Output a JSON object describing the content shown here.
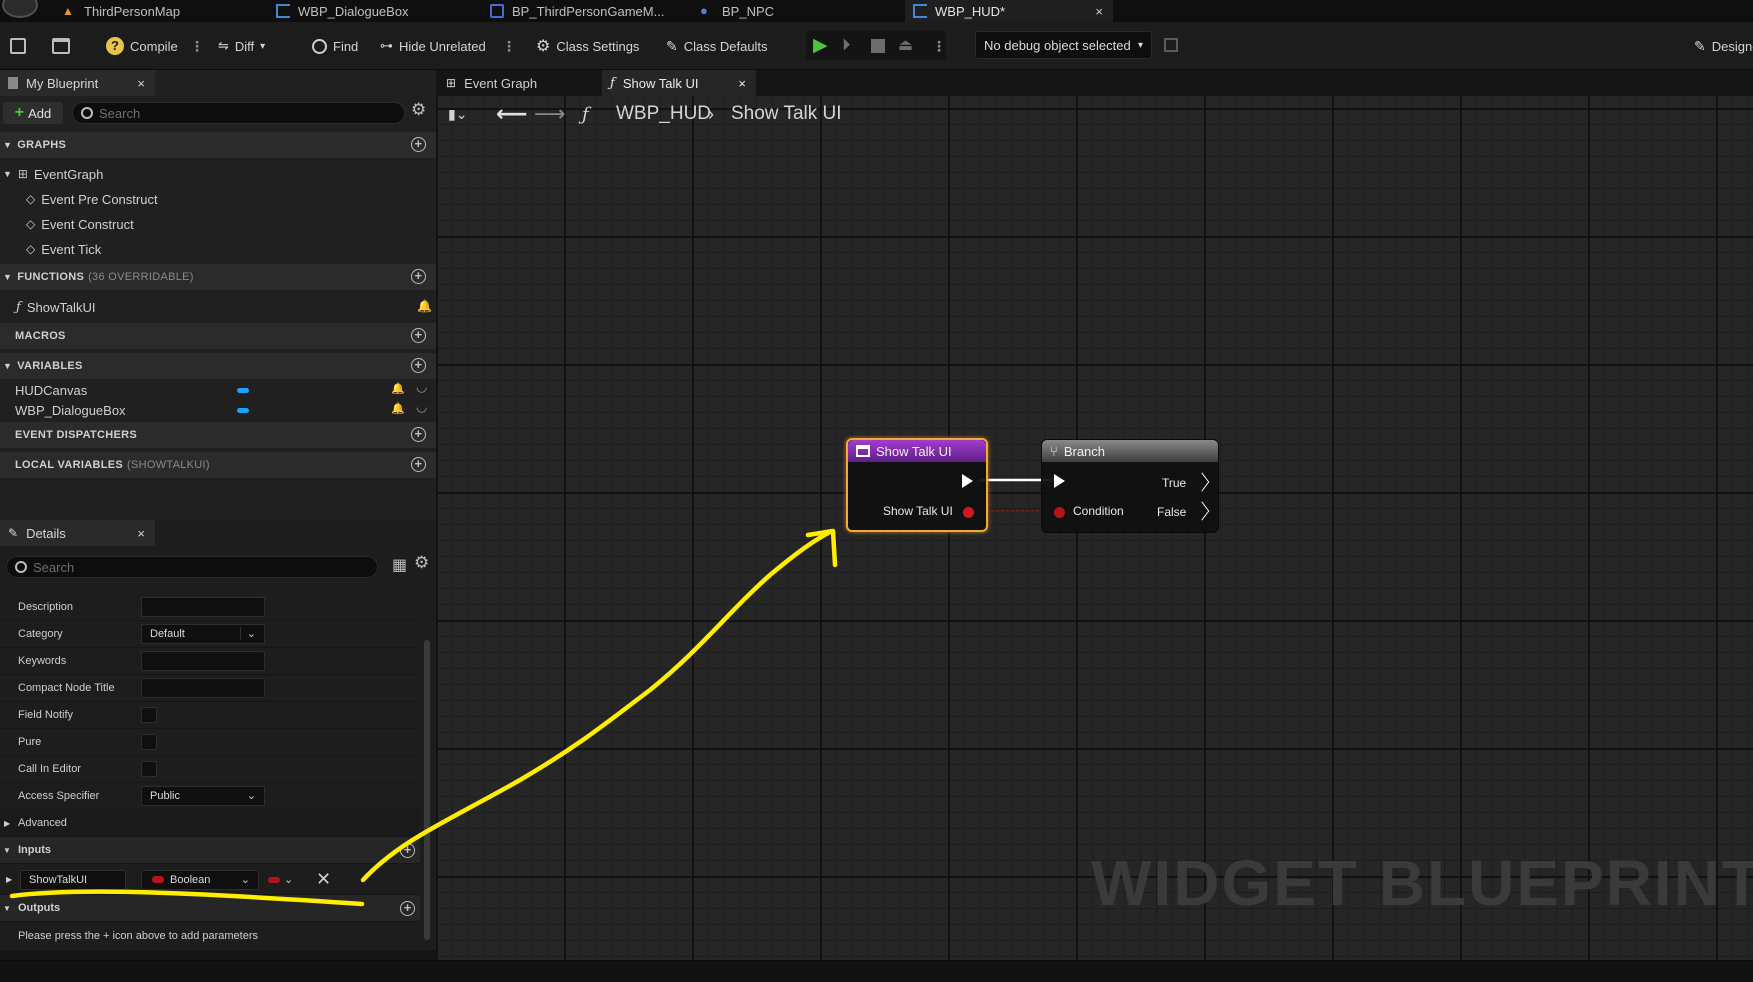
{
  "tabs": [
    {
      "label": "ThirdPersonMap",
      "icon": "level-icon"
    },
    {
      "label": "WBP_DialogueBox",
      "icon": "widget-blueprint-icon"
    },
    {
      "label": "BP_ThirdPersonGameM...",
      "icon": "blueprint-icon"
    },
    {
      "label": "BP_NPC",
      "icon": "character-icon"
    },
    {
      "label": "WBP_HUD*",
      "icon": "widget-blueprint-icon",
      "active": true
    }
  ],
  "toolbar": {
    "compile": "Compile",
    "diff": "Diff",
    "find": "Find",
    "hide_unrelated": "Hide Unrelated",
    "class_settings": "Class Settings",
    "class_defaults": "Class Defaults",
    "debug_select": "No debug object selected",
    "designer": "Designer"
  },
  "my_blueprint": {
    "tab_label": "My Blueprint",
    "add_label": "Add",
    "search_placeholder": "Search",
    "graphs_header": "GRAPHS",
    "event_graph": "EventGraph",
    "events": [
      "Event Pre Construct",
      "Event Construct",
      "Event Tick"
    ],
    "functions_header": "FUNCTIONS",
    "functions_sub": "(36 OVERRIDABLE)",
    "function_item": "ShowTalkUI",
    "macros_header": "MACROS",
    "variables_header": "VARIABLES",
    "variables": [
      "HUDCanvas",
      "WBP_DialogueBox"
    ],
    "dispatchers_header": "EVENT DISPATCHERS",
    "local_vars_header": "LOCAL VARIABLES",
    "local_vars_sub": "(SHOWTALKUI)"
  },
  "details": {
    "tab_label": "Details",
    "search_placeholder": "Search",
    "props": {
      "description": "Description",
      "category": "Category",
      "category_value": "Default",
      "keywords": "Keywords",
      "compact_title": "Compact Node Title",
      "field_notify": "Field Notify",
      "pure": "Pure",
      "call_in_editor": "Call In Editor",
      "access_specifier": "Access Specifier",
      "access_value": "Public"
    },
    "advanced": "Advanced",
    "inputs_header": "Inputs",
    "input_name": "ShowTalkUI",
    "input_type": "Boolean",
    "outputs_header": "Outputs",
    "outputs_hint": "Please press the + icon above to add parameters"
  },
  "graph": {
    "tabs": [
      "Event Graph",
      "Show Talk UI"
    ],
    "breadcrumb_root": "WBP_HUD",
    "breadcrumb_leaf": "Show Talk UI",
    "entry_node": {
      "title": "Show Talk UI",
      "pin": "Show Talk UI"
    },
    "branch_node": {
      "title": "Branch",
      "condition": "Condition",
      "true_label": "True",
      "false_label": "False"
    },
    "watermark": "WIDGET BLUEPRINT"
  },
  "colors": {
    "accent_orange": "#f2a93b",
    "function_purple": "#8a2fb0",
    "bool_red": "#b3151b",
    "variable_blue": "#1aa3ff",
    "annotation_yellow": "#ffee00"
  }
}
